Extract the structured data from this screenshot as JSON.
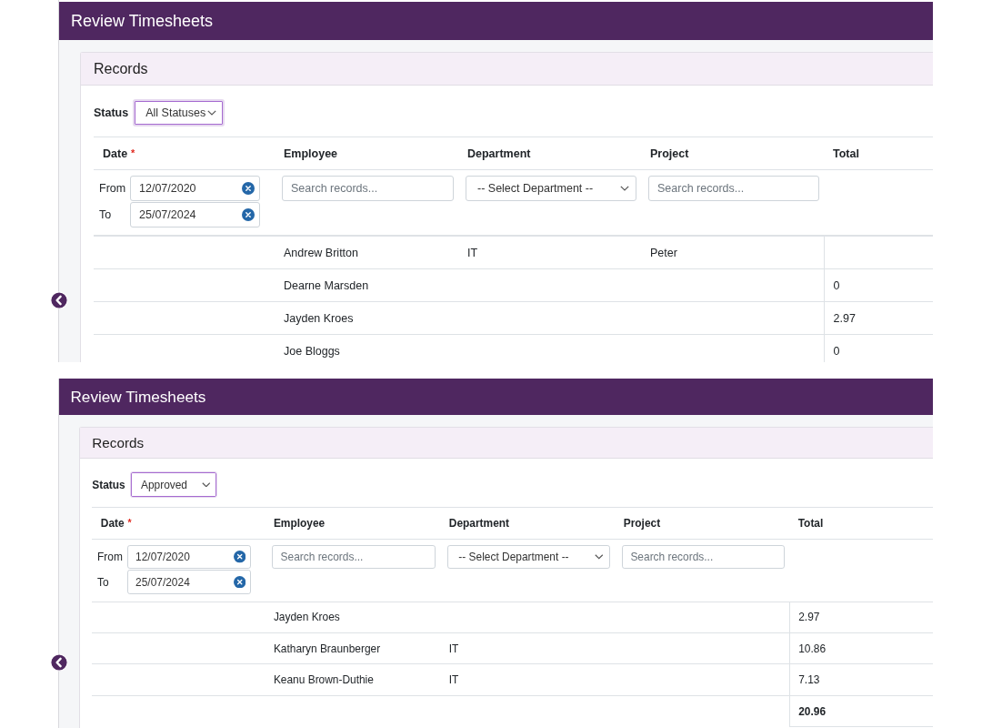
{
  "panels": [
    {
      "header": {
        "title": "Review Timesheets"
      },
      "card": {
        "title": "Records",
        "status_filter": {
          "label": "Status",
          "value": "All Statuses",
          "focused": true
        },
        "table": {
          "columns": [
            {
              "label": "Date",
              "required_mark": "*"
            },
            {
              "label": "Employee"
            },
            {
              "label": "Department"
            },
            {
              "label": "Project"
            },
            {
              "label": "Total"
            }
          ],
          "filters": {
            "date": [
              {
                "label": "From",
                "value": "12/07/2020"
              },
              {
                "label": "To",
                "value": "25/07/2024"
              }
            ],
            "employee": {
              "placeholder": "Search records..."
            },
            "department": {
              "value": "-- Select Department --"
            },
            "project": {
              "placeholder": "Search records..."
            }
          },
          "rows": [
            {
              "kind": "record",
              "employee": "Andrew Britton",
              "department": "IT",
              "project": "Peter"
            },
            {
              "kind": "record",
              "employee": "Dearne Marsden",
              "total": "0"
            },
            {
              "kind": "record",
              "employee": "Jayden Kroes",
              "total": "2.97"
            },
            {
              "kind": "record",
              "employee": "Joe Bloggs",
              "total": "0"
            }
          ]
        }
      }
    },
    {
      "header": {
        "title": "Review Timesheets"
      },
      "card": {
        "title": "Records",
        "status_filter": {
          "label": "Status",
          "value": "Approved",
          "focused": true
        },
        "table": {
          "columns": [
            {
              "label": "Date",
              "required_mark": "*"
            },
            {
              "label": "Employee"
            },
            {
              "label": "Department"
            },
            {
              "label": "Project"
            },
            {
              "label": "Total"
            }
          ],
          "filters": {
            "date": [
              {
                "label": "From",
                "value": "12/07/2020"
              },
              {
                "label": "To",
                "value": "25/07/2024"
              }
            ],
            "employee": {
              "placeholder": "Search records..."
            },
            "department": {
              "value": "-- Select Department --"
            },
            "project": {
              "placeholder": "Search records..."
            }
          },
          "rows": [
            {
              "kind": "record",
              "employee": "Jayden Kroes",
              "total": "2.97"
            },
            {
              "kind": "record",
              "employee": "Katharyn Braunberger",
              "department": "IT",
              "total": "10.86"
            },
            {
              "kind": "record",
              "employee": "Keanu Brown-Duthie",
              "department": "IT",
              "total": "7.13"
            },
            {
              "kind": "total",
              "total": "20.96"
            }
          ]
        }
      }
    }
  ]
}
